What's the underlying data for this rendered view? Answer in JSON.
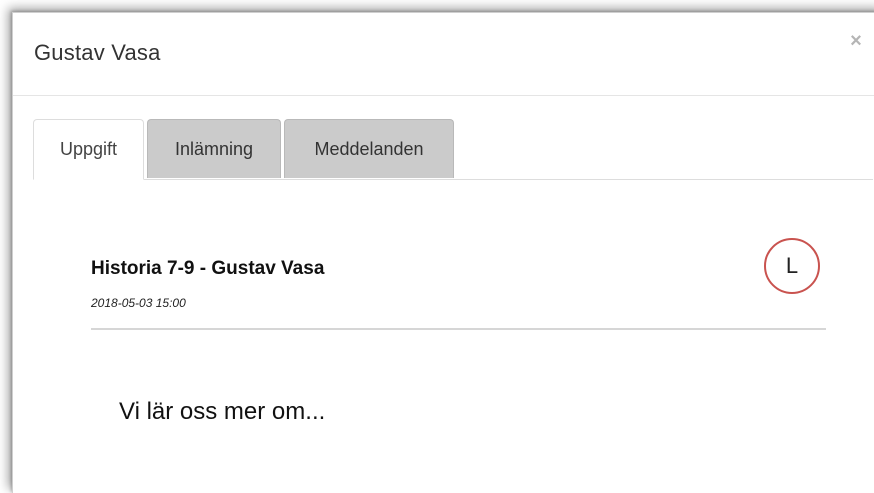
{
  "modal": {
    "title": "Gustav Vasa",
    "close_symbol": "×"
  },
  "tabs": [
    {
      "label": "Uppgift",
      "active": true
    },
    {
      "label": "Inlämning",
      "active": false
    },
    {
      "label": "Meddelanden",
      "active": false
    }
  ],
  "assignment": {
    "title": "Historia 7-9 - Gustav Vasa",
    "date": "2018-05-03 15:00",
    "avatar_letter": "L",
    "description": "Vi lär oss mer om..."
  },
  "colors": {
    "avatar_border": "#c9534f",
    "inactive_tab": "#cbcbcb"
  },
  "icons": {
    "close": "close-icon"
  }
}
